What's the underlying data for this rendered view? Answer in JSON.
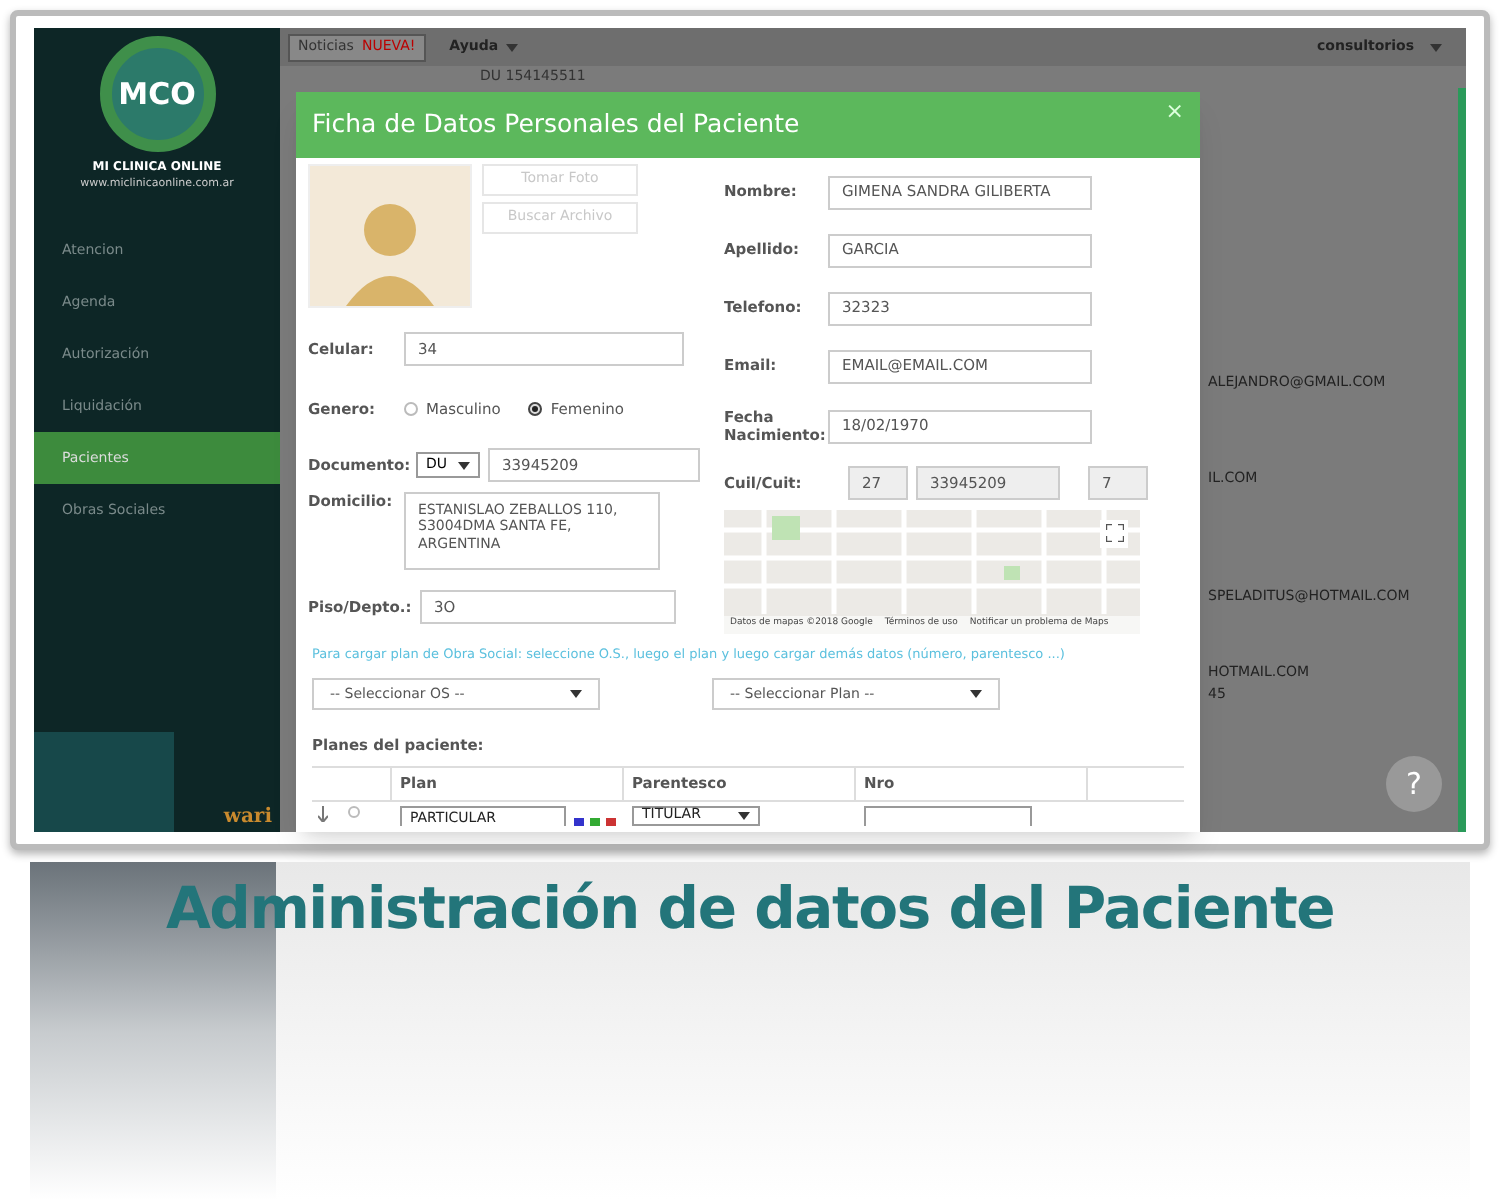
{
  "topbar": {
    "news_button": "Noticias",
    "news_badge": "NUEVA!",
    "help_menu": "Ayuda",
    "user_menu": "consultorios"
  },
  "sidebar": {
    "logo": "MCO",
    "brand": "MI CLINICA ONLINE",
    "url": "www.miclinicaonline.com.ar",
    "items": [
      {
        "label": "Atencion",
        "selected": false
      },
      {
        "label": "Agenda",
        "selected": false
      },
      {
        "label": "Autorización",
        "selected": false
      },
      {
        "label": "Liquidación",
        "selected": false
      },
      {
        "label": "Pacientes",
        "selected": true
      },
      {
        "label": "Obras Sociales",
        "selected": false
      }
    ],
    "footer_logo": "wari"
  },
  "background": {
    "list_text": "DU 154145511",
    "rows": [
      "ALEJANDRO@GMAIL.COM",
      "IL.COM",
      "SPELADITUS@HOTMAIL.COM",
      "HOTMAIL.COM",
      "45"
    ]
  },
  "modal": {
    "title": "Ficha de Datos Personales del Paciente",
    "close": "×",
    "photo_buttons": [
      {
        "label": "Tomar Foto",
        "disabled": true
      },
      {
        "label": "Buscar Archivo",
        "disabled": true
      }
    ],
    "celular": {
      "label": "Celular:",
      "value": "34"
    },
    "gender": {
      "label": "Genero:",
      "options": [
        {
          "label": "Masculino",
          "selected": false
        },
        {
          "label": "Femenino",
          "selected": true
        }
      ]
    },
    "documento": {
      "label": "Documento:",
      "type": "DU",
      "value": "33945209"
    },
    "domicilio": {
      "label": "Domicilio:",
      "value": "ESTANISLAO ZEBALLOS 110, S3004DMA SANTA FE, ARGENTINA"
    },
    "piso": {
      "label": "Piso/Depto.:",
      "value": "3O"
    },
    "nombre": {
      "label": "Nombre:",
      "value": "GIMENA SANDRA GILIBERTA"
    },
    "apellido": {
      "label": "Apellido:",
      "value": "GARCIA"
    },
    "telefono": {
      "label": "Telefono:",
      "value": "32323"
    },
    "email": {
      "label": "Email:",
      "value": "EMAIL@EMAIL.COM"
    },
    "fecha": {
      "label": "Fecha Nacimiento:",
      "value": "18/02/1970"
    },
    "cuil": {
      "label": "Cuil/Cuit:",
      "values": [
        "27",
        "33945209",
        "7"
      ]
    },
    "map": {
      "attribution": "Datos de mapas ©2018 Google",
      "terms": "Términos de uso",
      "report": "Notificar un problema de Maps"
    },
    "hint": "Para cargar plan de Obra Social: seleccione O.S., luego el plan y luego cargar demás datos (número, parentesco ...)",
    "os_select": "-- Seleccionar OS --",
    "plan_select": "-- Seleccionar Plan --",
    "plans_label": "Planes del paciente:",
    "plans_columns": [
      "Plan",
      "Parentesco",
      "Nro"
    ],
    "plans_rows": [
      {
        "plan": "PARTICULAR",
        "parentesco": "TITULAR",
        "selected": false
      }
    ]
  },
  "help_button": "?",
  "caption": "Administración de datos del Paciente"
}
